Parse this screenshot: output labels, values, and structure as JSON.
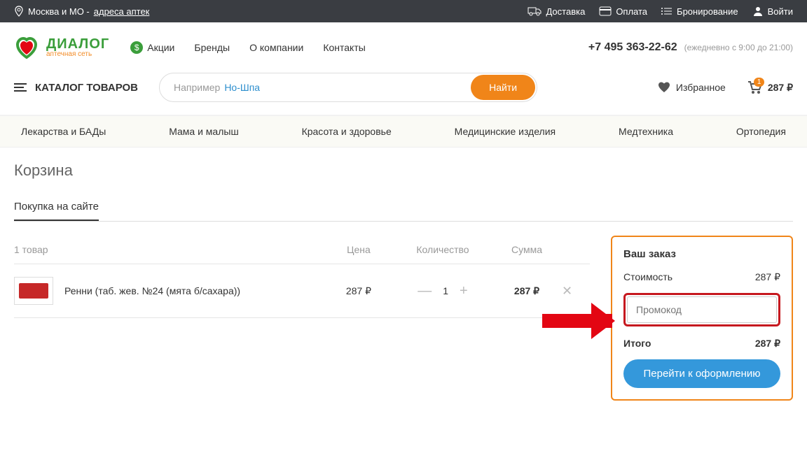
{
  "topbar": {
    "location_prefix": "Москва и МО - ",
    "location_link": "адреса аптек",
    "delivery": "Доставка",
    "payment": "Оплата",
    "booking": "Бронирование",
    "login": "Войти"
  },
  "logo": {
    "title": "ДИАЛОГ",
    "subtitle": "аптечная сеть"
  },
  "header_nav": {
    "promo": "Акции",
    "brands": "Бренды",
    "about": "О компании",
    "contacts": "Контакты"
  },
  "phone": {
    "number": "+7 495 363-22-62",
    "hours": "(ежедневно с 9:00 до 21:00)"
  },
  "catalog_btn": "КАТАЛОГ ТОВАРОВ",
  "search": {
    "prefix": "Например",
    "placeholder": "Но-Шпа",
    "button": "Найти"
  },
  "favorites": "Избранное",
  "cart_mini": {
    "count": "1",
    "total": "287"
  },
  "categories": [
    "Лекарства и БАДы",
    "Мама и малыш",
    "Красота и здоровье",
    "Медицинские изделия",
    "Медтехника",
    "Ортопедия"
  ],
  "page_title": "Корзина",
  "tab_label": "Покупка на сайте",
  "table": {
    "count_label": "1 товар",
    "price_h": "Цена",
    "qty_h": "Количество",
    "sum_h": "Сумма"
  },
  "item": {
    "name": "Ренни (таб. жев. №24 (мята б/сахара))",
    "price": "287",
    "qty": "1",
    "sum": "287"
  },
  "order": {
    "title": "Ваш заказ",
    "cost_label": "Стоимость",
    "cost_val": "287",
    "promo_placeholder": "Промокод",
    "total_label": "Итого",
    "total_val": "287",
    "checkout": "Перейти к оформлению"
  }
}
